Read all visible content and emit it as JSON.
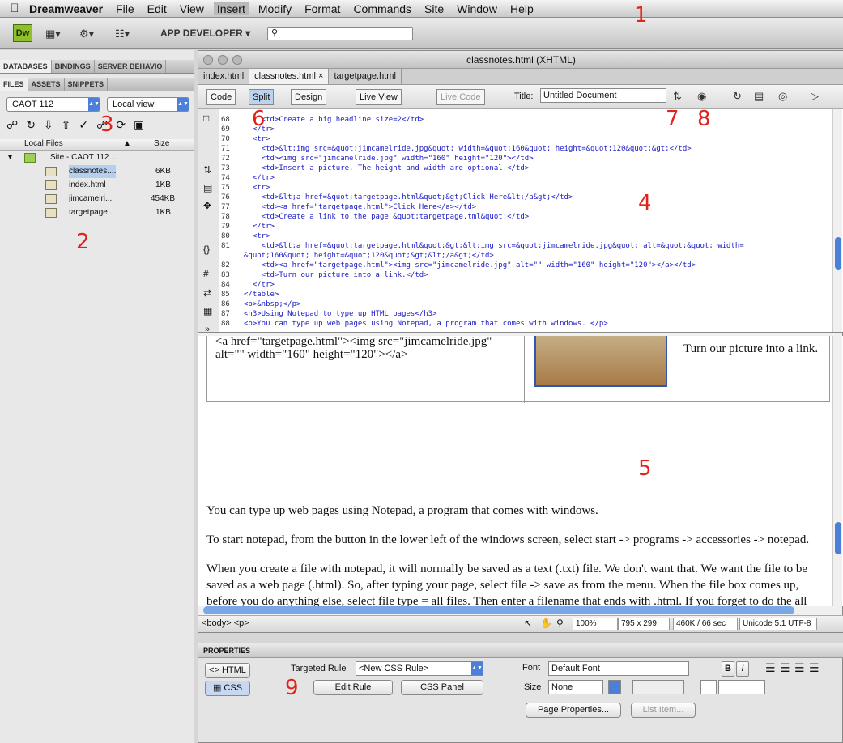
{
  "menubar": {
    "app": "Dreamweaver",
    "items": [
      "File",
      "Edit",
      "View",
      "Insert",
      "Modify",
      "Format",
      "Commands",
      "Site",
      "Window",
      "Help"
    ]
  },
  "appbar": {
    "logo": "Dw",
    "workspace": "APP DEVELOPER"
  },
  "annotations": [
    "1",
    "2",
    "3",
    "4",
    "5",
    "6",
    "7",
    "8",
    "9"
  ],
  "left_panel": {
    "tabs_top": [
      "DATABASES",
      "BINDINGS",
      "SERVER BEHAVIO"
    ],
    "tabs_files": [
      "FILES",
      "ASSETS",
      "SNIPPETS"
    ],
    "site_select": "CAOT 112",
    "view_select": "Local view",
    "col_local": "Local Files",
    "col_size": "Size",
    "site_root": "Site - CAOT 112...",
    "files": [
      {
        "name": "classnotes....",
        "size": "6KB"
      },
      {
        "name": "index.html",
        "size": "1KB"
      },
      {
        "name": "jimcamelri...",
        "size": "454KB"
      },
      {
        "name": "targetpage...",
        "size": "1KB"
      }
    ]
  },
  "doc": {
    "title": "classnotes.html (XHTML)",
    "tabs": [
      "index.html",
      "classnotes.html",
      "targetpage.html"
    ],
    "btn_code": "Code",
    "btn_split": "Split",
    "btn_design": "Design",
    "btn_live_view": "Live View",
    "btn_live_code": "Live Code",
    "title_label": "Title:",
    "title_value": "Untitled Document"
  },
  "code_lines": [
    {
      "n": "68",
      "t": "    <td>Create a big headline size=2</td>"
    },
    {
      "n": "69",
      "t": "  </tr>"
    },
    {
      "n": "70",
      "t": "  <tr>"
    },
    {
      "n": "71",
      "t": "    <td>&lt;img src=&quot;jimcamelride.jpg&quot; width=&quot;160&quot; height=&quot;120&quot;&gt;</td>"
    },
    {
      "n": "72",
      "t": "    <td><img src=\"jimcamelride.jpg\" width=\"160\" height=\"120\"></td>"
    },
    {
      "n": "73",
      "t": "    <td>Insert a picture. The height and width are optional.</td>"
    },
    {
      "n": "74",
      "t": "  </tr>"
    },
    {
      "n": "75",
      "t": "  <tr>"
    },
    {
      "n": "76",
      "t": "    <td>&lt;a href=&quot;targetpage.html&quot;&gt;Click Here&lt;/a&gt;</td>"
    },
    {
      "n": "77",
      "t": "    <td><a href=\"targetpage.html\">Click Here</a></td>"
    },
    {
      "n": "78",
      "t": "    <td>Create a link to the page &quot;targetpage.tml&quot;</td>"
    },
    {
      "n": "79",
      "t": "  </tr>"
    },
    {
      "n": "80",
      "t": "  <tr>"
    },
    {
      "n": "81",
      "t": "    <td>&lt;a href=&quot;targetpage.html&quot;&gt;&lt;img src=&quot;jimcamelride.jpg&quot; alt=&quot;&quot; width="
    },
    {
      "n": "",
      "t": "&quot;160&quot; height=&quot;120&quot;&gt;&lt;/a&gt;</td>"
    },
    {
      "n": "82",
      "t": "    <td><a href=\"targetpage.html\"><img src=\"jimcamelride.jpg\" alt=\"\" width=\"160\" height=\"120\"></a></td>"
    },
    {
      "n": "83",
      "t": "    <td>Turn our picture into a link.</td>"
    },
    {
      "n": "84",
      "t": "  </tr>"
    },
    {
      "n": "85",
      "t": "</table>"
    },
    {
      "n": "86",
      "t": "<p>&nbsp;</p>"
    },
    {
      "n": "87",
      "t": "<h3>Using Notepad to type up HTML pages</h3>"
    },
    {
      "n": "88",
      "t": "<p>You can type up web pages using Notepad, a program that comes with windows. </p>"
    }
  ],
  "design": {
    "cell_code": "<a href=\"targetpage.html\"><img src=\"jimcamelride.jpg\" alt=\"\" width=\"160\" height=\"120\"></a>",
    "cell_desc": "Turn our picture into a link.",
    "p1": "You can type up web pages using Notepad, a program that comes with windows.",
    "p2": "To start notepad, from the button in the lower left of the windows screen, select start -> programs -> accessories -> notepad.",
    "p3": "When you create a file with notepad, it will normally be saved as a text (.txt) file. We don't want that. We want the file to be saved as a web page (.html). So, after typing your page, select file -> save as from the menu. When the file box comes up, before you do anything else, select file type = all files. Then enter a filename that ends with .html. If you forget to do the all files"
  },
  "status": {
    "tags": "<body> <p>",
    "zoom": "100%",
    "size": "795 x 299",
    "dl": "460K / 66 sec",
    "enc": "Unicode 5.1 UTF-8"
  },
  "props": {
    "title": "PROPERTIES",
    "html": "HTML",
    "css": "CSS",
    "targeted_rule_label": "Targeted Rule",
    "targeted_rule": "<New CSS Rule>",
    "edit_rule": "Edit Rule",
    "css_panel": "CSS Panel",
    "font_label": "Font",
    "font": "Default Font",
    "size_label": "Size",
    "size": "None",
    "bold": "B",
    "italic": "I",
    "page_props": "Page Properties...",
    "list_item": "List Item..."
  }
}
